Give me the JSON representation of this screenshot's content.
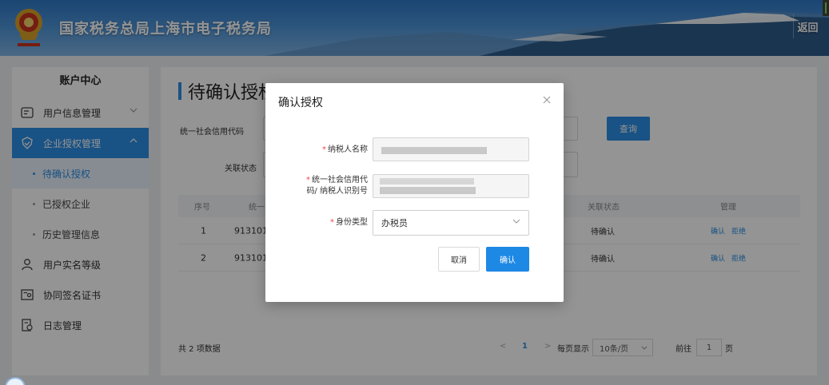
{
  "header": {
    "title": "国家税务总局上海市电子税务局",
    "back_label": "返回"
  },
  "sidebar": {
    "title": "账户中心",
    "items": [
      {
        "label": "用户信息管理",
        "icon": "id-card-icon"
      },
      {
        "label": "企业授权管理",
        "icon": "shield-check-icon"
      },
      {
        "label": "待确认授权"
      },
      {
        "label": "已授权企业"
      },
      {
        "label": "历史管理信息"
      },
      {
        "label": "用户实名等级",
        "icon": "user-icon"
      },
      {
        "label": "协同签名证书",
        "icon": "certificate-icon"
      },
      {
        "label": "日志管理",
        "icon": "log-icon"
      }
    ]
  },
  "main": {
    "page_title": "待确认授权",
    "filters": {
      "credit_code_label": "统一社会信用代码",
      "status_label": "关联状态",
      "query_label": "查询"
    },
    "table": {
      "columns": [
        "序号",
        "统一",
        "关联状态",
        "管理"
      ],
      "rows": [
        {
          "index": "1",
          "code": "913101",
          "status": "待确认",
          "confirm": "确认",
          "reject": "拒绝"
        },
        {
          "index": "2",
          "code": "913101",
          "status": "待确认",
          "confirm": "确认",
          "reject": "拒绝"
        }
      ]
    },
    "footer": {
      "total": "共 2 项数据",
      "prev": "<",
      "page": "1",
      "next": ">",
      "per_page_label": "每页显示",
      "per_page_value": "10条/页",
      "goto_label": "前往",
      "goto_value": "1",
      "page_unit": "页"
    }
  },
  "modal": {
    "title": "确认授权",
    "close_icon": "close-icon",
    "fields": {
      "taxpayer_name_label": "纳税人名称",
      "credit_code_label_line1": "统一社会信用代",
      "credit_code_label_line2": "码/ 纳税人识别号",
      "identity_type_label": "身份类型",
      "identity_type_value": "办税员"
    },
    "cancel_label": "取消",
    "confirm_label": "确认"
  },
  "colors": {
    "primary": "#2b8de3",
    "required": "#f04848",
    "sidebar_active": "#2b8de3"
  }
}
